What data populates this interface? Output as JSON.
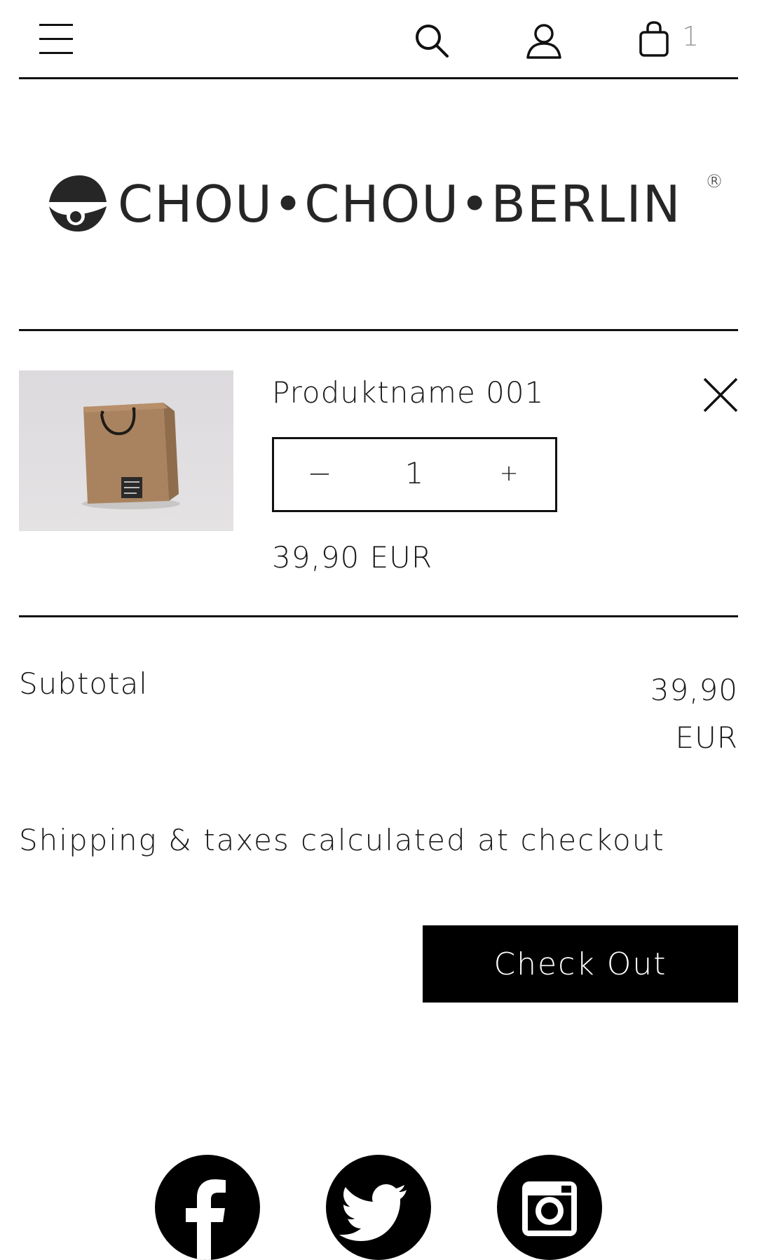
{
  "header": {
    "menu_icon": "hamburger-menu-icon",
    "search_icon": "search-icon",
    "account_icon": "user-icon",
    "cart_icon": "shopping-bag-icon",
    "cart_count": "1"
  },
  "logo": {
    "text": "CHOU•CHOU•BERLIN",
    "registered": "®"
  },
  "cart": {
    "items": [
      {
        "name": "Produktname 001",
        "quantity": "1",
        "decrement_label": "−",
        "increment_label": "+",
        "price": "39,90 EUR",
        "image": "brown-paper-gift-bag"
      }
    ],
    "subtotal_label": "Subtotal",
    "subtotal_value": "39,90 EUR",
    "shipping_note": "Shipping & taxes calculated at checkout",
    "checkout_label": "Check Out"
  },
  "social": [
    "facebook-icon",
    "twitter-icon",
    "instagram-icon"
  ],
  "colors": {
    "text": "#1a1a1a",
    "button_bg": "#000000",
    "button_text": "#ffffff",
    "cart_count": "#9a9a9a"
  }
}
